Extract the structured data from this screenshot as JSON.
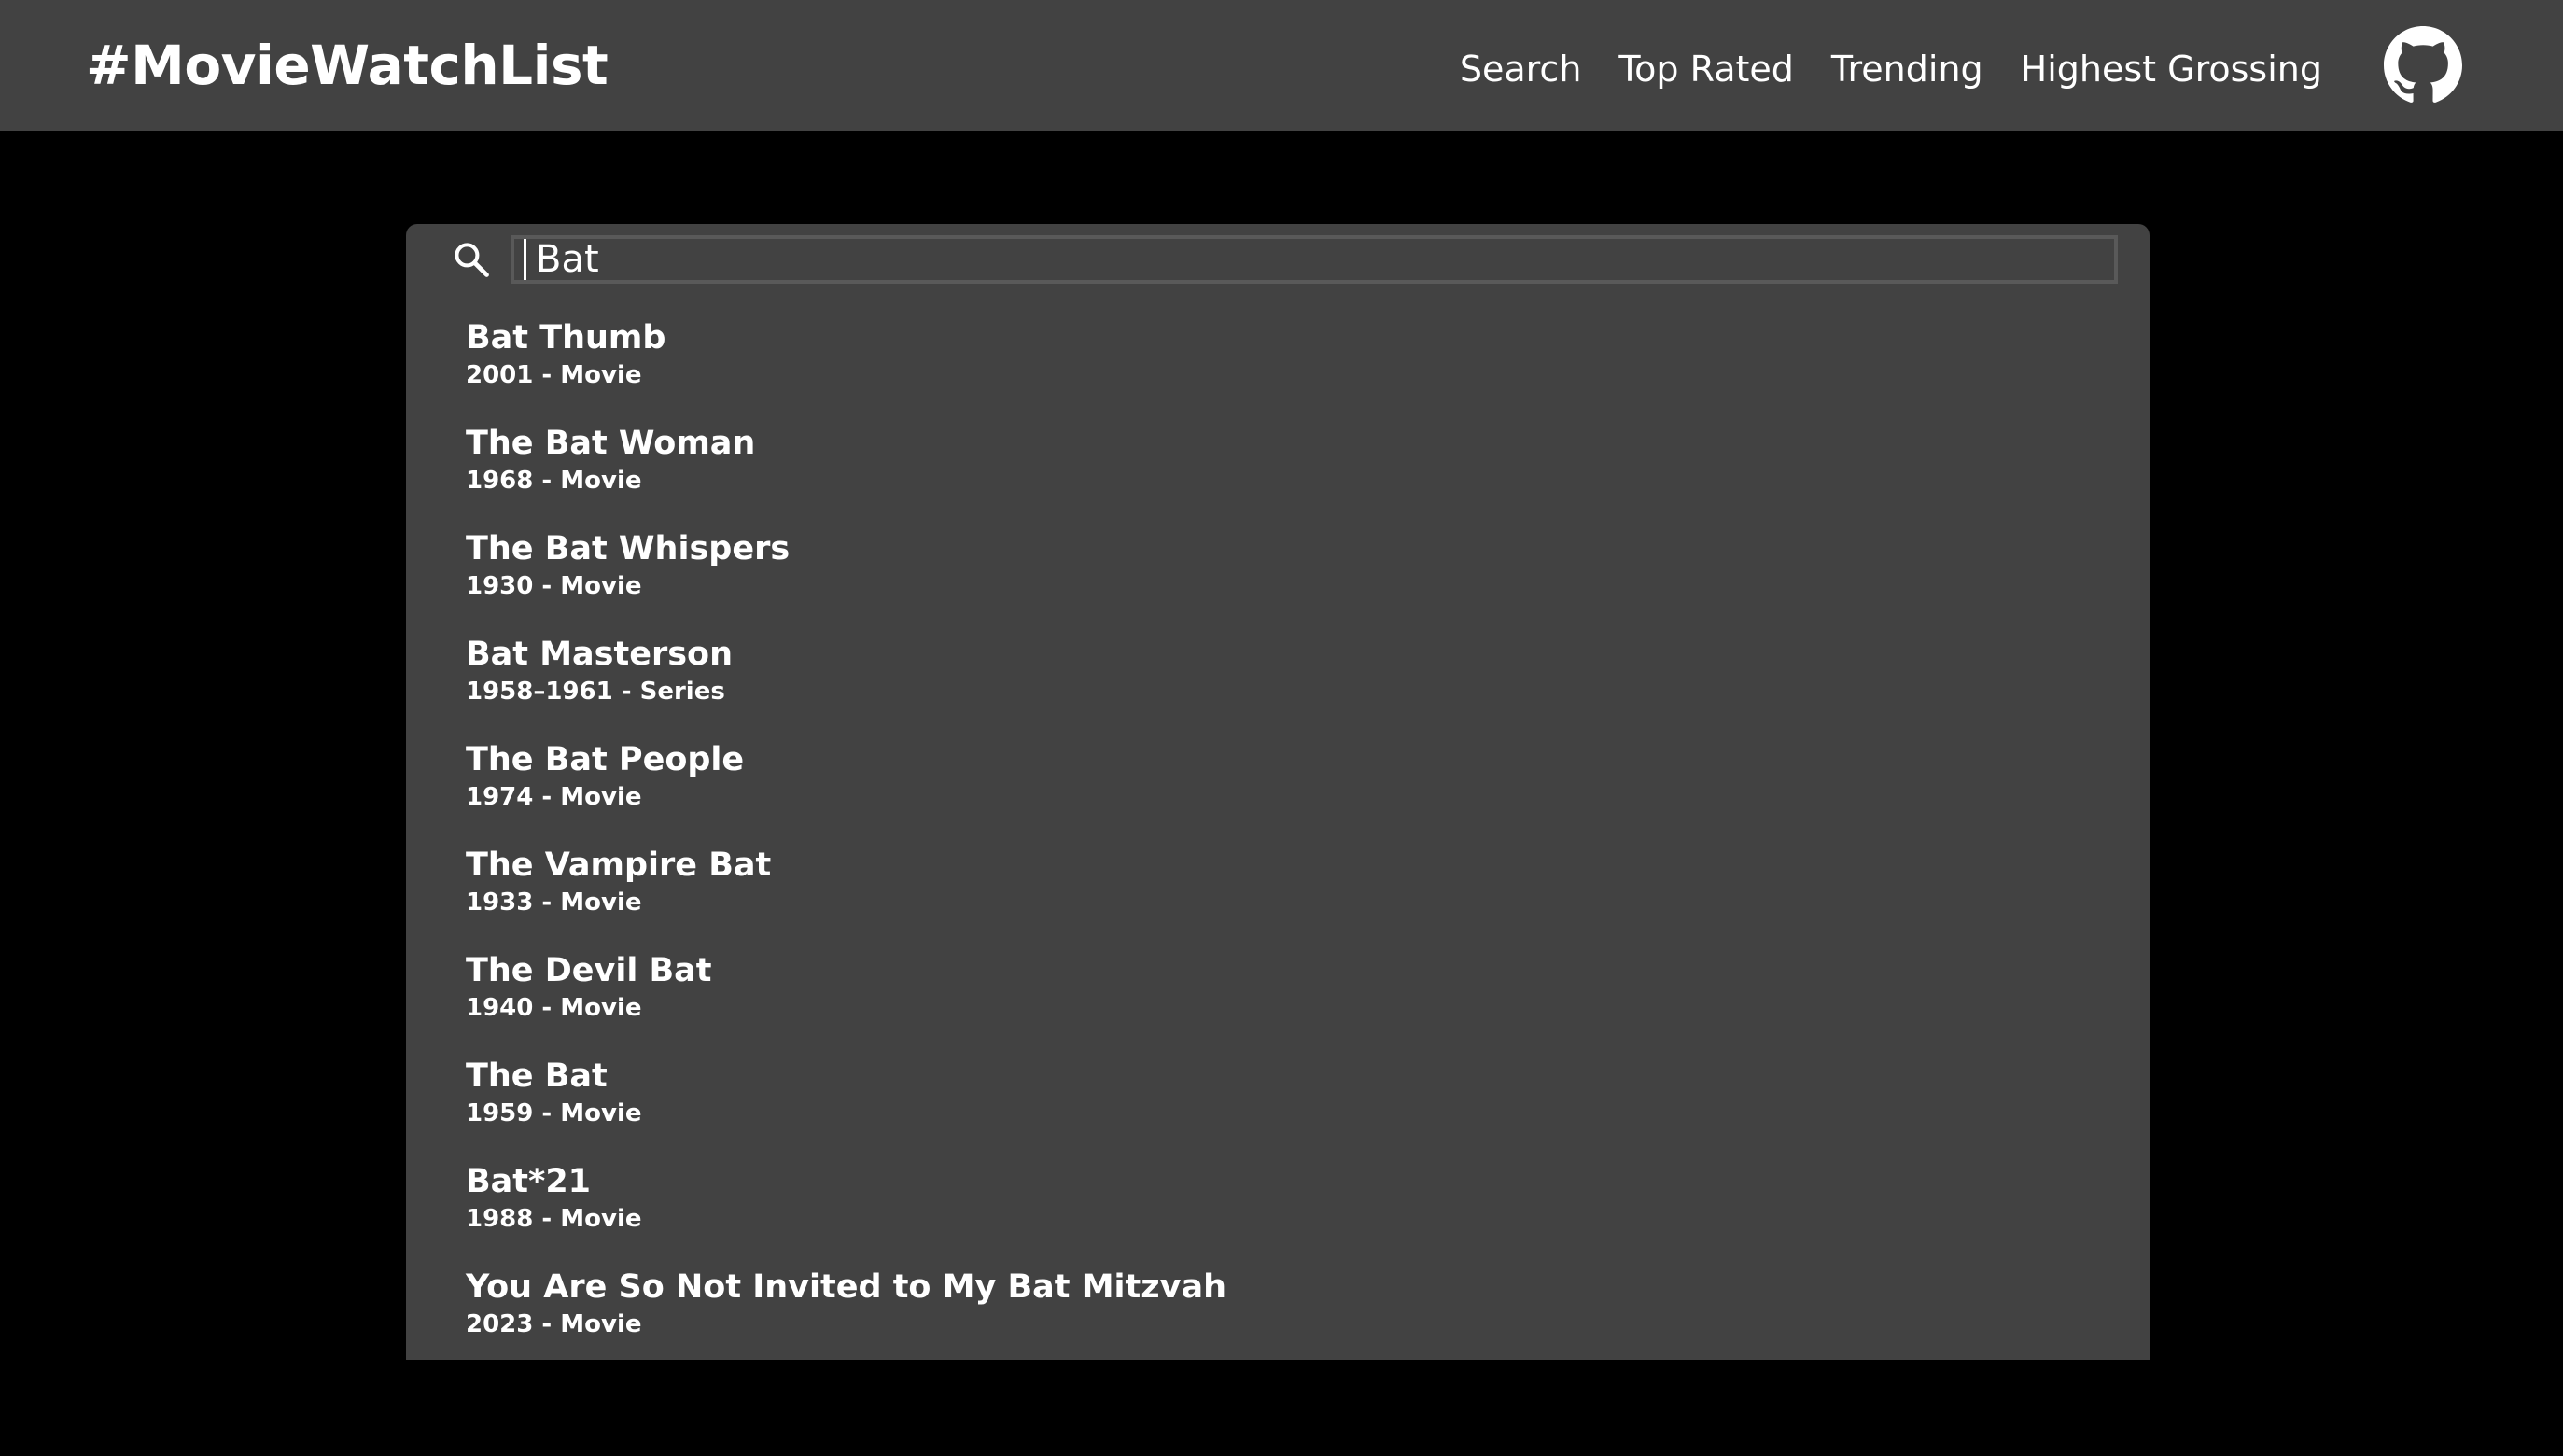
{
  "header": {
    "brand": "#MovieWatchList",
    "nav": [
      {
        "label": "Search"
      },
      {
        "label": "Top Rated"
      },
      {
        "label": "Trending"
      },
      {
        "label": "Highest Grossing"
      }
    ],
    "github_icon": "github-icon"
  },
  "search": {
    "value": "Bat",
    "icon": "search-icon"
  },
  "results": [
    {
      "title": "Bat Thumb",
      "meta": "2001 - Movie"
    },
    {
      "title": "The Bat Woman",
      "meta": "1968 - Movie"
    },
    {
      "title": "The Bat Whispers",
      "meta": "1930 - Movie"
    },
    {
      "title": "Bat Masterson",
      "meta": "1958–1961 - Series"
    },
    {
      "title": "The Bat People",
      "meta": "1974 - Movie"
    },
    {
      "title": "The Vampire Bat",
      "meta": "1933 - Movie"
    },
    {
      "title": "The Devil Bat",
      "meta": "1940 - Movie"
    },
    {
      "title": "The Bat",
      "meta": "1959 - Movie"
    },
    {
      "title": "Bat*21",
      "meta": "1988 - Movie"
    },
    {
      "title": "You Are So Not Invited to My Bat Mitzvah",
      "meta": "2023 - Movie"
    }
  ],
  "colors": {
    "page_background": "#000000",
    "bar_background": "#424242",
    "input_border": "#595959",
    "text": "#ffffff"
  }
}
